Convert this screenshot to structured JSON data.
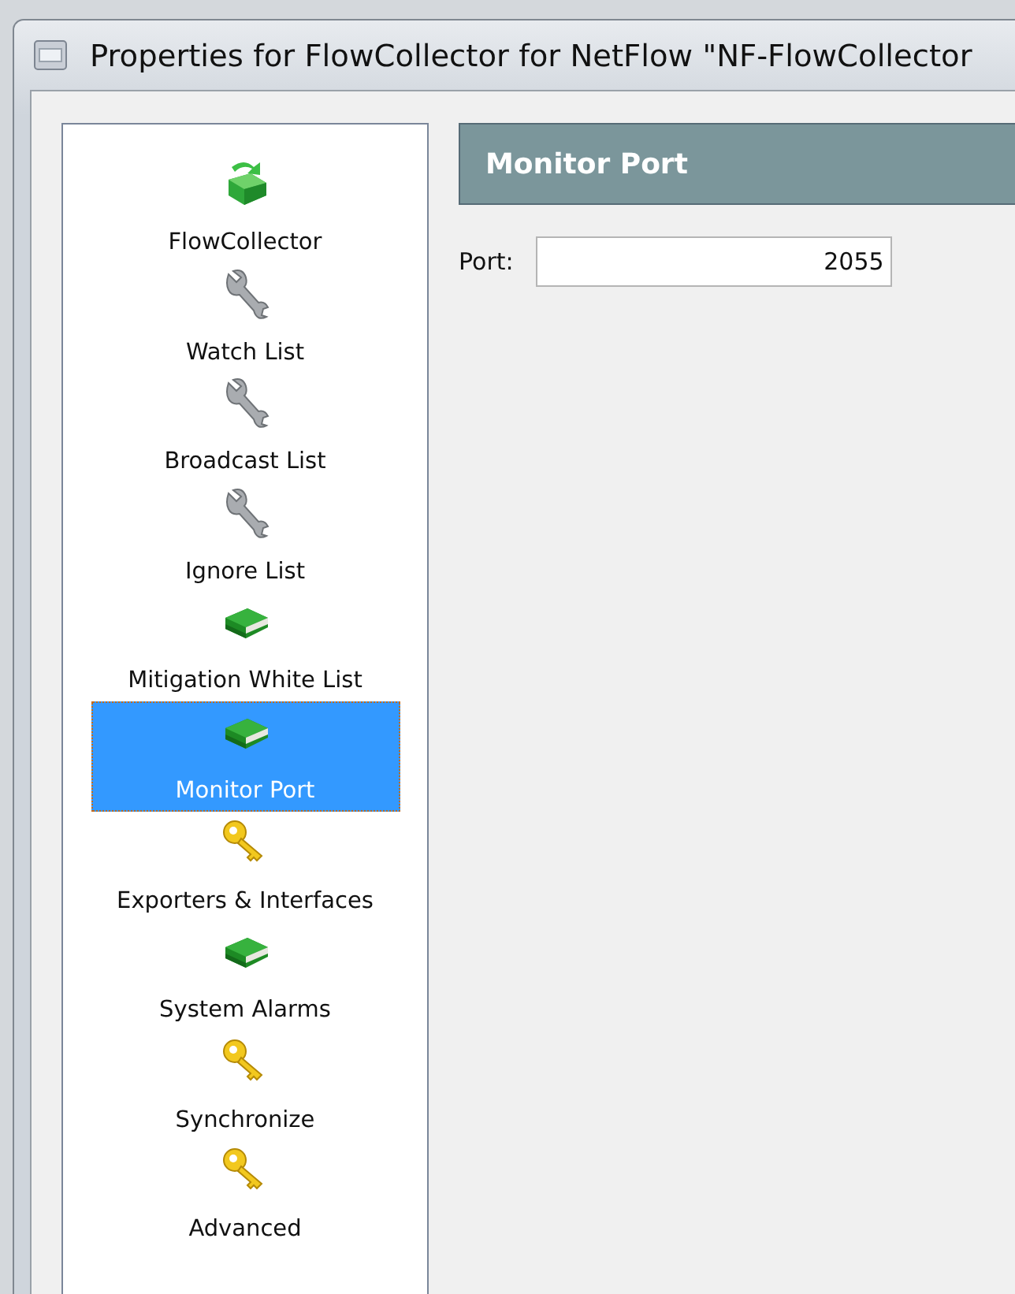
{
  "window": {
    "title": "Properties for FlowCollector for NetFlow \"NF-FlowCollector"
  },
  "sidebar": {
    "items": [
      {
        "label": "FlowCollector",
        "kind": "appliance",
        "selected": false
      },
      {
        "label": "Watch List",
        "kind": "wrench",
        "selected": false
      },
      {
        "label": "Broadcast List",
        "kind": "wrench",
        "selected": false
      },
      {
        "label": "Ignore List",
        "kind": "wrench",
        "selected": false
      },
      {
        "label": "Mitigation White List",
        "kind": "book",
        "selected": false
      },
      {
        "label": "Monitor Port",
        "kind": "book",
        "selected": true
      },
      {
        "label": "Exporters & Interfaces",
        "kind": "key",
        "selected": false
      },
      {
        "label": "System Alarms",
        "kind": "book",
        "selected": false
      },
      {
        "label": "Synchronize",
        "kind": "key",
        "selected": false
      },
      {
        "label": "Advanced",
        "kind": "key",
        "selected": false
      }
    ]
  },
  "panel": {
    "title": "Monitor Port",
    "fields": [
      {
        "label": "Port:",
        "value": "2055"
      }
    ]
  }
}
